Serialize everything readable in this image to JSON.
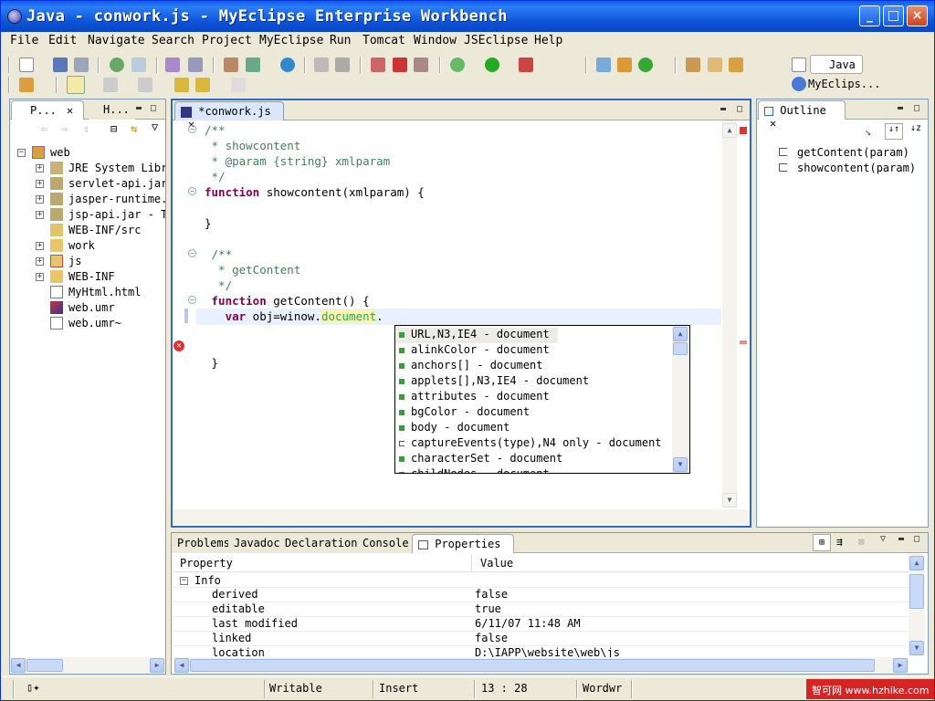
{
  "window": {
    "title": "Java - conwork.js - MyEclipse Enterprise Workbench"
  },
  "menu": [
    "File",
    "Edit",
    "Navigate",
    "Search",
    "Project",
    "MyEclipse",
    "Run",
    "Tomcat",
    "Window",
    "JSEclipse",
    "Help"
  ],
  "perspectives": {
    "java": "Java",
    "myeclipse": "MyEclips..."
  },
  "package_explorer": {
    "tabs": [
      "P...",
      "H..."
    ],
    "items": [
      {
        "label": "web"
      },
      {
        "label": "JRE System Libr"
      },
      {
        "label": "servlet-api.jar"
      },
      {
        "label": "jasper-runtime."
      },
      {
        "label": "jsp-api.jar - T"
      },
      {
        "label": "WEB-INF/src"
      },
      {
        "label": "work"
      },
      {
        "label": "js"
      },
      {
        "label": "WEB-INF"
      },
      {
        "label": "MyHtml.html"
      },
      {
        "label": "web.umr"
      },
      {
        "label": "web.umr~"
      }
    ]
  },
  "editor": {
    "tab": "*conwork.js",
    "lines": [
      {
        "parts": [
          {
            "t": "/**",
            "c": "cmt"
          }
        ]
      },
      {
        "parts": [
          {
            "t": " * showcontent",
            "c": "cmt"
          }
        ]
      },
      {
        "parts": [
          {
            "t": " * @param {string} xmlparam",
            "c": "cmt"
          }
        ]
      },
      {
        "parts": [
          {
            "t": " */",
            "c": "cmt"
          }
        ]
      },
      {
        "parts": [
          {
            "t": "function",
            "c": "kw"
          },
          {
            "t": " showcontent(xmlparam) {",
            "c": ""
          }
        ]
      },
      {
        "parts": [
          {
            "t": "",
            "c": ""
          }
        ]
      },
      {
        "parts": [
          {
            "t": "}",
            "c": ""
          }
        ]
      },
      {
        "parts": [
          {
            "t": "",
            "c": ""
          }
        ]
      },
      {
        "parts": [
          {
            "t": " /**",
            "c": "cmt"
          }
        ]
      },
      {
        "parts": [
          {
            "t": "  * getContent",
            "c": "cmt"
          }
        ]
      },
      {
        "parts": [
          {
            "t": "  */",
            "c": "cmt"
          }
        ]
      },
      {
        "parts": [
          {
            "t": " function",
            "c": "kw"
          },
          {
            "t": " getContent() {",
            "c": ""
          }
        ]
      },
      {
        "parts": [
          {
            "t": "   var",
            "c": "kw"
          },
          {
            "t": " obj=winow.",
            "c": ""
          },
          {
            "t": "document",
            "c": "hl"
          },
          {
            "t": ".",
            "c": ""
          }
        ]
      },
      {
        "parts": [
          {
            "t": "",
            "c": ""
          }
        ]
      },
      {
        "parts": [
          {
            "t": "",
            "c": ""
          }
        ]
      },
      {
        "parts": [
          {
            "t": " }",
            "c": ""
          }
        ]
      }
    ]
  },
  "completion": {
    "items": [
      "URL,N3,IE4 - document",
      "alinkColor - document",
      "anchors[] - document",
      "applets[],N3,IE4 - document",
      "attributes - document",
      "bgColor - document",
      "body - document",
      "captureEvents(type),N4 only - document",
      "characterSet - document",
      "childNodes - document"
    ]
  },
  "outline": {
    "title": "Outline",
    "items": [
      "getContent(param)",
      "showcontent(param)"
    ]
  },
  "bottom": {
    "tabs": [
      "Problems",
      "Javadoc",
      "Declaration",
      "Console",
      "Properties"
    ],
    "headers": {
      "property": "Property",
      "value": "Value"
    },
    "group": "Info",
    "rows": [
      {
        "p": "derived",
        "v": "false"
      },
      {
        "p": "editable",
        "v": "true"
      },
      {
        "p": "last modified",
        "v": "6/11/07 11:48 AM"
      },
      {
        "p": "linked",
        "v": "false"
      },
      {
        "p": "location",
        "v": "D:\\IAPP\\website\\web\\js"
      }
    ]
  },
  "status": {
    "writable": "Writable",
    "insert": "Insert",
    "position": "13 : 28",
    "wordwrap": "Wordwr",
    "watermark": "智可网 www.hzhike.com"
  }
}
